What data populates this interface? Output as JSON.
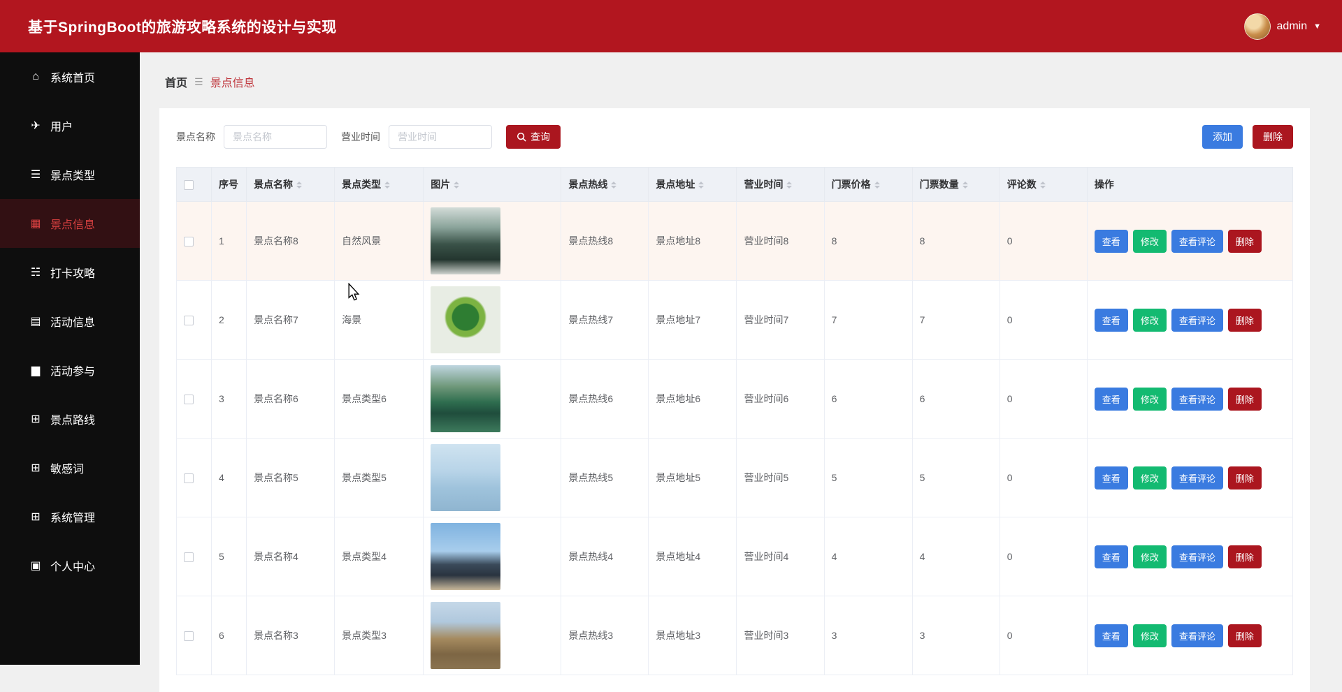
{
  "header": {
    "title": "基于SpringBoot的旅游攻略系统的设计与实现",
    "user": "admin",
    "user_caret": "▼"
  },
  "colors": {
    "primary_red": "#b2161f",
    "button_blue": "#3a7be0",
    "button_green": "#13ba71",
    "sidebar_black": "#0e0e0e",
    "row_highlight": "#fdf5f0"
  },
  "sidebar": {
    "items": [
      {
        "label": "系统首页",
        "icon": "home-icon",
        "active": false
      },
      {
        "label": "用户",
        "icon": "send-icon",
        "active": false
      },
      {
        "label": "景点类型",
        "icon": "list-icon",
        "active": false
      },
      {
        "label": "景点信息",
        "icon": "monitor-icon",
        "active": true
      },
      {
        "label": "打卡攻略",
        "icon": "sliders-icon",
        "active": false
      },
      {
        "label": "活动信息",
        "icon": "calendar-icon",
        "active": false
      },
      {
        "label": "活动参与",
        "icon": "bar-chart-icon",
        "active": false
      },
      {
        "label": "景点路线",
        "icon": "grid-icon",
        "active": false
      },
      {
        "label": "敏感词",
        "icon": "grid-icon",
        "active": false
      },
      {
        "label": "系统管理",
        "icon": "grid-icon",
        "active": false
      },
      {
        "label": "个人中心",
        "icon": "id-card-icon",
        "active": false
      }
    ]
  },
  "breadcrumb": {
    "home": "首页",
    "separator": "☰",
    "current": "景点信息"
  },
  "toolbar": {
    "name_label": "景点名称",
    "name_placeholder": "景点名称",
    "name_value": "",
    "time_label": "营业时间",
    "time_placeholder": "营业时间",
    "time_value": "",
    "search_label": "查询",
    "add_label": "添加",
    "delete_label": "删除"
  },
  "table": {
    "headers": [
      {
        "label": "序号",
        "sortable": false
      },
      {
        "label": "景点名称",
        "sortable": true
      },
      {
        "label": "景点类型",
        "sortable": true
      },
      {
        "label": "图片",
        "sortable": true
      },
      {
        "label": "景点热线",
        "sortable": true
      },
      {
        "label": "景点地址",
        "sortable": true
      },
      {
        "label": "营业时间",
        "sortable": true
      },
      {
        "label": "门票价格",
        "sortable": true
      },
      {
        "label": "门票数量",
        "sortable": true
      },
      {
        "label": "评论数",
        "sortable": true
      },
      {
        "label": "操作",
        "sortable": false
      }
    ],
    "actions": [
      {
        "label": "查看",
        "style": "blue",
        "name": "view-button"
      },
      {
        "label": "修改",
        "style": "green",
        "name": "edit-button"
      },
      {
        "label": "查看评论",
        "style": "blue",
        "name": "view-comments-button"
      },
      {
        "label": "删除",
        "style": "red",
        "name": "delete-button"
      }
    ],
    "rows": [
      {
        "no": "1",
        "name": "景点名称8",
        "type": "自然风景",
        "photo": "misty-mountains-photo",
        "hotline": "景点热线8",
        "address": "景点地址8",
        "time": "营业时间8",
        "price": "8",
        "qty": "8",
        "comments": "0",
        "highlighted": true
      },
      {
        "no": "2",
        "name": "景点名称7",
        "type": "海景",
        "photo": "green-leaf-photo",
        "hotline": "景点热线7",
        "address": "景点地址7",
        "time": "营业时间7",
        "price": "7",
        "qty": "7",
        "comments": "0",
        "highlighted": false
      },
      {
        "no": "3",
        "name": "景点名称6",
        "type": "景点类型6",
        "photo": "lake-mountains-photo",
        "hotline": "景点热线6",
        "address": "景点地址6",
        "time": "营业时间6",
        "price": "6",
        "qty": "6",
        "comments": "0",
        "highlighted": false
      },
      {
        "no": "4",
        "name": "景点名称5",
        "type": "景点类型5",
        "photo": "lake-boat-photo",
        "hotline": "景点热线5",
        "address": "景点地址5",
        "time": "营业时间5",
        "price": "5",
        "qty": "5",
        "comments": "0",
        "highlighted": false
      },
      {
        "no": "5",
        "name": "景点名称4",
        "type": "景点类型4",
        "photo": "temple-photo",
        "hotline": "景点热线4",
        "address": "景点地址4",
        "time": "营业时间4",
        "price": "4",
        "qty": "4",
        "comments": "0",
        "highlighted": false
      },
      {
        "no": "6",
        "name": "景点名称3",
        "type": "景点类型3",
        "photo": "ancient-building-photo",
        "hotline": "景点热线3",
        "address": "景点地址3",
        "time": "营业时间3",
        "price": "3",
        "qty": "3",
        "comments": "0",
        "highlighted": false
      }
    ]
  }
}
